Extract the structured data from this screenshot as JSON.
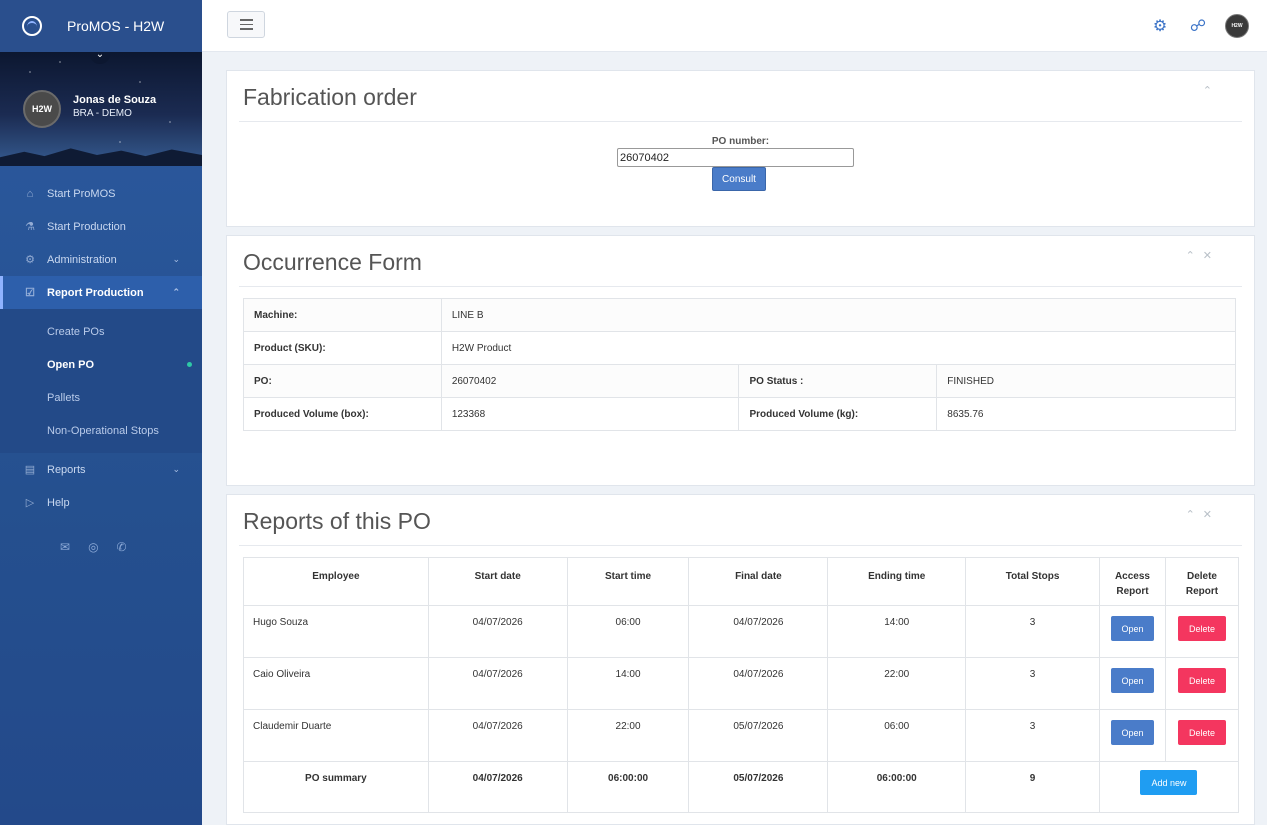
{
  "app": {
    "title": "ProMOS - H2W"
  },
  "user": {
    "name": "Jonas de Souza",
    "role": "BRA - DEMO",
    "avatar_text": "H2W"
  },
  "sidebar": {
    "items": [
      {
        "label": "Start ProMOS",
        "icon": "home-icon"
      },
      {
        "label": "Start Production",
        "icon": "flask-icon"
      },
      {
        "label": "Administration",
        "icon": "gears-icon"
      },
      {
        "label": "Report Production",
        "icon": "checkbox-icon"
      },
      {
        "label": "Reports",
        "icon": "bar-chart-icon"
      },
      {
        "label": "Help",
        "icon": "play-circle-icon"
      }
    ],
    "subitems": [
      {
        "label": "Create POs"
      },
      {
        "label": "Open PO"
      },
      {
        "label": "Pallets"
      },
      {
        "label": "Non-Operational Stops"
      }
    ]
  },
  "topbar": {
    "avatar_text": "H2W"
  },
  "fabrication": {
    "title": "Fabrication order",
    "po_label": "PO number:",
    "po_value": "26070402",
    "consult_label": "Consult"
  },
  "occurrence": {
    "title": "Occurrence Form",
    "machine_label": "Machine:",
    "machine_value": "LINE B",
    "product_label": "Product (SKU):",
    "product_value": "H2W Product",
    "po_label": "PO:",
    "po_value": "26070402",
    "status_label": "PO Status :",
    "status_value": "FINISHED",
    "vol_box_label": "Produced Volume (box):",
    "vol_box_value": "123368",
    "vol_kg_label": "Produced Volume (kg):",
    "vol_kg_value": "8635.76"
  },
  "reports": {
    "title": "Reports of this PO",
    "headers": [
      "Employee",
      "Start date",
      "Start time",
      "Final date",
      "Ending time",
      "Total Stops",
      "Access Report",
      "Delete Report"
    ],
    "rows": [
      {
        "employee": "Hugo Souza",
        "start_date": "04/07/2026",
        "start_time": "06:00",
        "final_date": "04/07/2026",
        "end_time": "14:00",
        "stops": "3"
      },
      {
        "employee": "Caio Oliveira",
        "start_date": "04/07/2026",
        "start_time": "14:00",
        "final_date": "04/07/2026",
        "end_time": "22:00",
        "stops": "3"
      },
      {
        "employee": "Claudemir Duarte",
        "start_date": "04/07/2026",
        "start_time": "22:00",
        "final_date": "05/07/2026",
        "end_time": "06:00",
        "stops": "3"
      }
    ],
    "open_label": "Open",
    "delete_label": "Delete",
    "summary": {
      "label": "PO summary",
      "start_date": "04/07/2026",
      "start_time": "06:00:00",
      "final_date": "05/07/2026",
      "end_time": "06:00:00",
      "stops": "9"
    },
    "add_label": "Add new"
  }
}
